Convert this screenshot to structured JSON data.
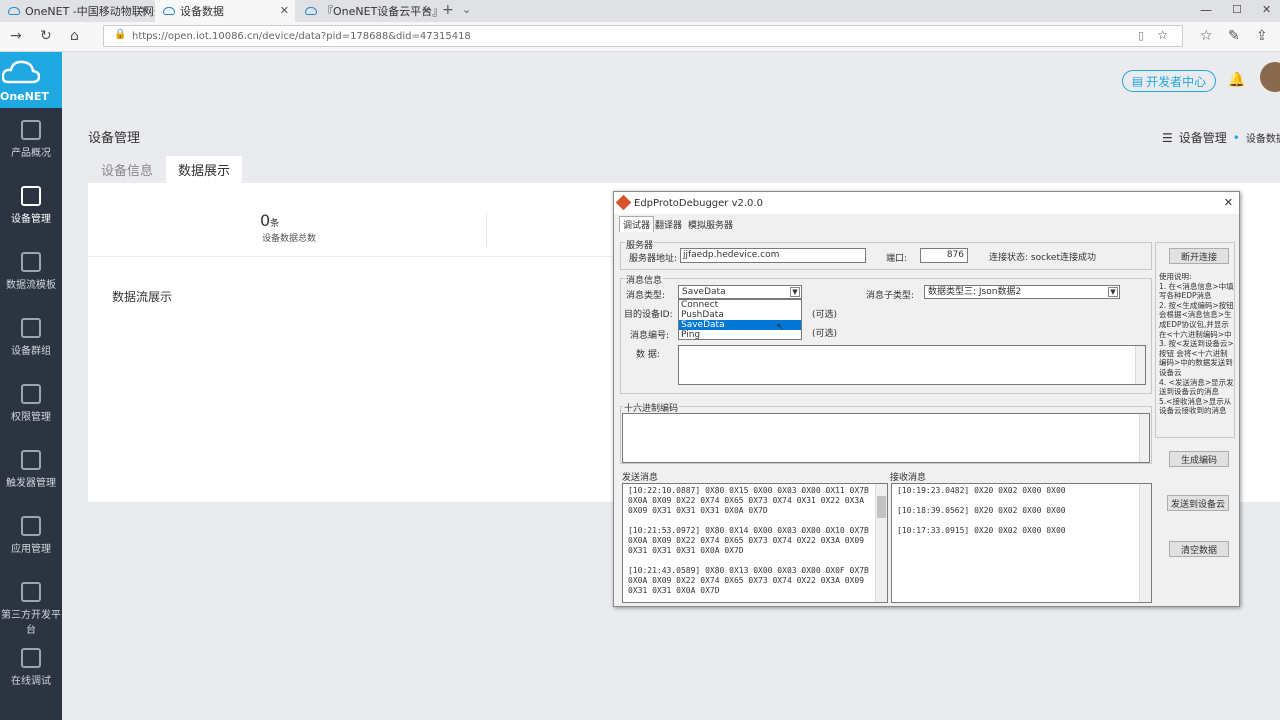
{
  "browser": {
    "tabs": [
      {
        "title": "OneNET -中国移动物联网开"
      },
      {
        "title": "设备数据"
      },
      {
        "title": "『OneNET设备云平台』云"
      }
    ],
    "url": "https://open.iot.10086.cn/device/data?pid=178688&did=47315418"
  },
  "sidebar": {
    "logo": "OneNET",
    "items": [
      {
        "label": "产品概况"
      },
      {
        "label": "设备管理"
      },
      {
        "label": "数据流模板"
      },
      {
        "label": "设备群组"
      },
      {
        "label": "权限管理"
      },
      {
        "label": "触发器管理"
      },
      {
        "label": "应用管理"
      },
      {
        "label": "第三方开发平台"
      },
      {
        "label": "在线调试"
      }
    ]
  },
  "header": {
    "dev_center": "开发者中心"
  },
  "page": {
    "title": "设备管理",
    "breadcrumb": {
      "root": "设备管理",
      "sep": "•",
      "current": "设备数据"
    },
    "tabs": [
      {
        "label": "设备信息"
      },
      {
        "label": "数据展示"
      }
    ],
    "stat": {
      "count": "0",
      "unit": "条",
      "label": "设备数据总数"
    },
    "stream_title": "数据流展示"
  },
  "dialog": {
    "title": "EdpProtoDebugger v2.0.0",
    "tabs": [
      {
        "label": "调试器"
      },
      {
        "label": "翻译器"
      },
      {
        "label": "模拟服务器"
      }
    ],
    "server": {
      "group": "服务器",
      "addr_label": "服务器地址:",
      "addr": "jjfaedp.hedevice.com",
      "port_label": "端口:",
      "port": "876",
      "status": "连接状态: socket连接成功",
      "disconnect": "断开连接"
    },
    "msg": {
      "group": "消息信息",
      "type_label": "消息类型:",
      "type_value": "SaveData",
      "options": [
        "Connect",
        "PushData",
        "SaveData",
        "Ping"
      ],
      "subtype_label": "消息子类型:",
      "subtype_value": "数据类型三: Json数据2",
      "dest_label": "目的设备ID:",
      "optional": "(可选)",
      "num_label": "消息编号:",
      "data_label": "数 据:"
    },
    "hex_group": "十六进制编码",
    "help": "使用说明:\n1. 在<消息信息>中填写各种EDP消息\n2. 按<生成编码>按钮 会根据<消息信息>生成EDP协议包,并显示在<十六进制编码>中\n3. 按<发送到设备云>按钮 会将<十六进制编码>中的数据发送到设备云\n4. <发送消息>显示发送到设备云的消息\n5.<接收消息>显示从设备云接收到的消息",
    "buttons": {
      "gen": "生成编码",
      "send": "发送到设备云",
      "clear": "清空数据"
    },
    "sent_label": "发送消息",
    "recv_label": "接收消息",
    "sent": "[10:22:10.0887] 0X80 0X15 0X00 0X03 0X00 0X11 0X7B 0X0A 0X09 0X22 0X74 0X65 0X73 0X74 0X31 0X22 0X3A 0X09 0X31 0X31 0X31 0X0A 0X7D\n\n[10:21:53.0972] 0X80 0X14 0X00 0X03 0X00 0X10 0X7B 0X0A 0X09 0X22 0X74 0X65 0X73 0X74 0X22 0X3A 0X09 0X31 0X31 0X31 0X0A 0X7D\n\n[10:21:43.0589] 0X80 0X13 0X00 0X03 0X00 0X0F 0X7B 0X0A 0X09 0X22 0X74 0X65 0X73 0X74 0X22 0X3A 0X09 0X31 0X31 0X0A 0X7D",
    "recv": "[10:19:23.0482] 0X20 0X02 0X00 0X00\n\n[10:18:39.0562] 0X20 0X02 0X00 0X00\n\n[10:17:33.0915] 0X20 0X02 0X00 0X00"
  },
  "colors": {
    "accent": "#1fa8e2",
    "sidebar": "#2b3440",
    "selection": "#0078d7"
  }
}
